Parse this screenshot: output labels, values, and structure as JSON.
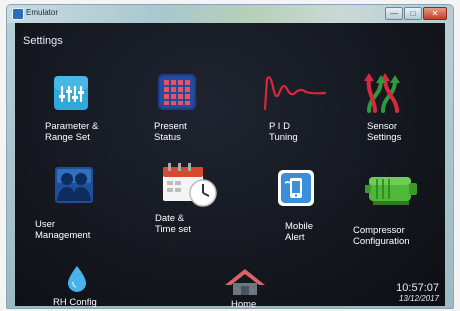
{
  "window": {
    "title": "Emulator",
    "controls": {
      "minimize": "—",
      "maximize": "□",
      "close": "✕"
    }
  },
  "screen": {
    "heading": "Settings",
    "tiles": [
      {
        "id": "parameter-range-set",
        "label_lines": [
          "Parameter &",
          "Range Set"
        ],
        "icon": "sliders-icon",
        "color": "#2fa8dc"
      },
      {
        "id": "present-status",
        "label_lines": [
          "Present",
          "Status"
        ],
        "icon": "keypad-grid-icon",
        "color": "#e35560"
      },
      {
        "id": "pid-tuning",
        "label_lines": [
          "P I D",
          "Tuning"
        ],
        "icon": "damped-wave-icon",
        "color": "#d8283a"
      },
      {
        "id": "sensor-settings",
        "label_lines": [
          "Sensor",
          "Settings"
        ],
        "icon": "sensor-arrows-icon",
        "color": "#2e9a3c"
      },
      {
        "id": "user-management",
        "label_lines": [
          "User",
          "Management"
        ],
        "icon": "users-icon",
        "color": "#2b68b8"
      },
      {
        "id": "date-time-set",
        "label_lines": [
          "Date &",
          "Time set"
        ],
        "icon": "calendar-clock-icon",
        "color": "#d84a2e"
      },
      {
        "id": "mobile-alert",
        "label_lines": [
          "Mobile",
          "Alert"
        ],
        "icon": "mobile-alert-icon",
        "color": "#3a8fd8"
      },
      {
        "id": "compressor-configuration",
        "label_lines": [
          "Compressor",
          "Configuration"
        ],
        "icon": "compressor-icon",
        "color": "#4fb83a"
      },
      {
        "id": "rh-config",
        "label_lines": [
          "RH Config"
        ],
        "icon": "water-drop-icon",
        "color": "#4ab2e8"
      },
      {
        "id": "home",
        "label_lines": [
          "Home"
        ],
        "icon": "home-icon",
        "color": "#d8646a"
      }
    ],
    "clock": {
      "time": "10:57:07",
      "date": "13/12/2017"
    }
  }
}
